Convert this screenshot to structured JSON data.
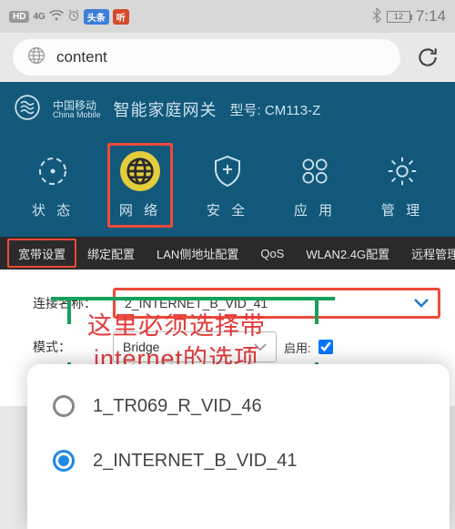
{
  "status": {
    "hd": "HD",
    "net": "4G",
    "app1": "头条",
    "app2": "听",
    "battery": "12",
    "time": "7:14"
  },
  "url": {
    "value": "content"
  },
  "router": {
    "brand_cn": "中国移动",
    "brand_en": "China Mobile",
    "title": "智能家庭网关",
    "model_label": "型号: CM113-Z"
  },
  "nav": {
    "status": "状 态",
    "network": "网 络",
    "security": "安 全",
    "apps": "应 用",
    "manage": "管 理"
  },
  "subnav": {
    "broadband": "宽带设置",
    "binding": "绑定配置",
    "lan": "LAN侧地址配置",
    "qos": "QoS",
    "wlan24": "WLAN2.4G配置",
    "remote": "远程管理"
  },
  "form": {
    "conn_name_label": "连接名称：",
    "conn_name_value": "2_INTERNET_B_VID_41",
    "mode_label": "模式：",
    "mode_value": "Bridge",
    "enable_label": "启用:"
  },
  "note": {
    "line1": "这里必须选择带",
    "line2": "internet的选项"
  },
  "options": {
    "o1": "1_TR069_R_VID_46",
    "o2": "2_INTERNET_B_VID_41"
  }
}
